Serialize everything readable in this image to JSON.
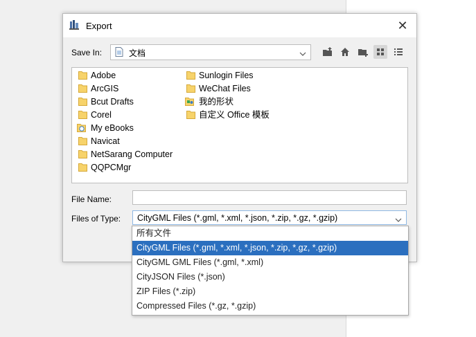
{
  "dialog": {
    "title": "Export",
    "save_in_label": "Save In:",
    "save_in_value": "文档",
    "file_name_label": "File Name:",
    "file_name_value": "",
    "file_type_label": "Files of Type:",
    "file_type_value": "CityGML Files (*.gml, *.xml, *.json, *.zip, *.gz, *.gzip)"
  },
  "toolbar": {
    "icons": [
      "up-folder-icon",
      "home-icon",
      "new-folder-icon",
      "list-view-icon",
      "details-view-icon"
    ],
    "active": "list-view-icon"
  },
  "files": [
    {
      "name": "Adobe",
      "icon": "folder-icon"
    },
    {
      "name": "ArcGIS",
      "icon": "folder-icon"
    },
    {
      "name": "Bcut Drafts",
      "icon": "folder-icon"
    },
    {
      "name": "Corel",
      "icon": "folder-icon"
    },
    {
      "name": "My eBooks",
      "icon": "ebook-folder-icon"
    },
    {
      "name": "Navicat",
      "icon": "folder-icon"
    },
    {
      "name": "NetSarang Computer",
      "icon": "folder-icon"
    },
    {
      "name": "QQPCMgr",
      "icon": "folder-icon"
    },
    {
      "name": "Sunlogin Files",
      "icon": "folder-icon"
    },
    {
      "name": "WeChat Files",
      "icon": "folder-icon"
    },
    {
      "name": "我的形状",
      "icon": "shapes-folder-icon"
    },
    {
      "name": "自定义 Office 模板",
      "icon": "folder-icon"
    }
  ],
  "type_options": [
    "所有文件",
    "CityGML Files (*.gml, *.xml, *.json, *.zip, *.gz, *.gzip)",
    "CityGML GML Files (*.gml, *.xml)",
    "CityJSON Files (*.json)",
    "ZIP Files (*.zip)",
    "Compressed Files (*.gz, *.gzip)"
  ],
  "selected_option_index": 1,
  "colors": {
    "selection": "#2b6fbf",
    "folder": "#f7d36b",
    "background": "#f0f0f0"
  }
}
